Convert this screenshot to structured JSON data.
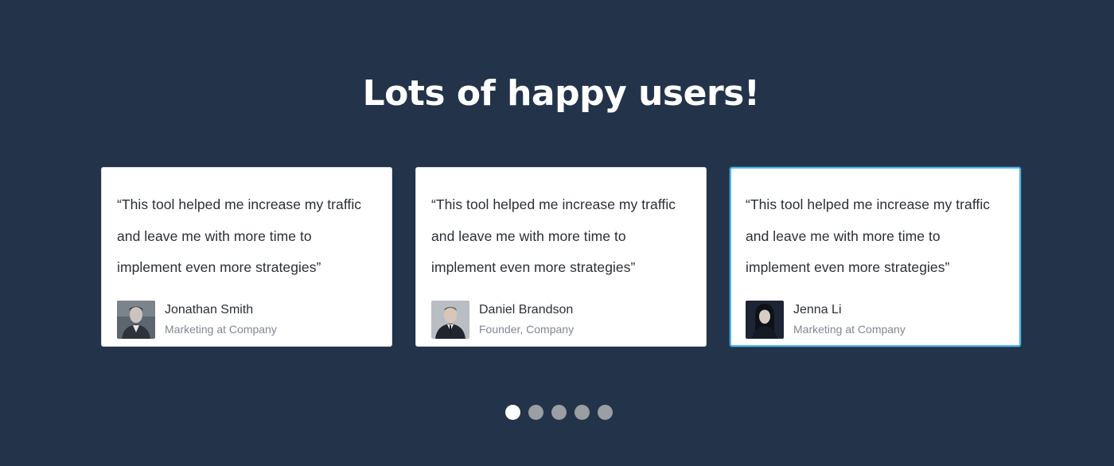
{
  "section": {
    "title": "Lots of happy users!"
  },
  "testimonials": [
    {
      "quote": "“This tool helped me increase my traffic and leave me with more time to implement even more strategies”",
      "name": "Jonathan Smith",
      "role": "Marketing at Company",
      "avatar_icon": "person-photo-icon",
      "active": false
    },
    {
      "quote": "“This tool helped me increase my traffic and leave me with more time to implement even more strategies”",
      "name": "Daniel Brandson",
      "role": "Founder, Company",
      "avatar_icon": "person-photo-icon",
      "active": false
    },
    {
      "quote": "“This tool helped me increase my traffic and leave me with more time to implement even more strategies”",
      "name": "Jenna Li",
      "role": "Marketing at Company",
      "avatar_icon": "person-photo-icon",
      "active": true
    }
  ],
  "pagination": {
    "count": 5,
    "active_index": 0
  },
  "colors": {
    "background": "#22334a",
    "card_background": "#ffffff",
    "active_card_border": "#4fb4ef",
    "dot_active": "#ffffff",
    "dot_inactive": "#9b9ea3"
  }
}
